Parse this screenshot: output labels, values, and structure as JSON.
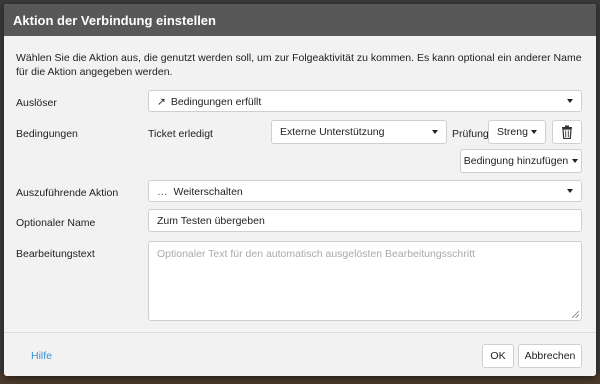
{
  "dialog": {
    "title": "Aktion der Verbindung einstellen",
    "intro": "Wählen Sie die Aktion aus, die genutzt werden soll, um zur Folgeaktivität zu kommen. Es kann optional ein anderer Name für die Aktion angegeben werden."
  },
  "trigger": {
    "label": "Auslöser",
    "icon": "↗",
    "value": "Bedingungen erfüllt"
  },
  "conditions": {
    "label": "Bedingungen",
    "subject": "Ticket erledigt",
    "value_select": "Externe Unterstützung",
    "check_label": "Prüfung",
    "check_select": "Streng",
    "add_button": "Bedingung hinzufügen"
  },
  "action": {
    "label": "Auszuführende Aktion",
    "icon": "…",
    "value": "Weiterschalten"
  },
  "optional_name": {
    "label": "Optionaler Name",
    "value": "Zum Testen übergeben"
  },
  "edit_text": {
    "label": "Bearbeitungstext",
    "placeholder": "Optionaler Text für den automatisch ausgelösten Bearbeitungsschritt"
  },
  "footer": {
    "help": "Hilfe",
    "ok": "OK",
    "cancel": "Abbrechen"
  }
}
